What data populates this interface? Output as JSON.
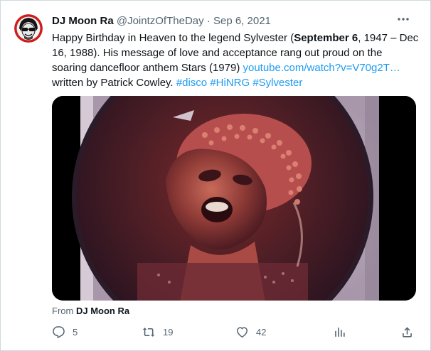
{
  "tweet": {
    "author_name": "DJ Moon Ra",
    "handle": "@JointzOfTheDay",
    "separator": "·",
    "date": "Sep 6, 2021",
    "text_parts": {
      "p1": "Happy Birthday in Heaven to the legend Sylvester (",
      "bold": "September 6",
      "p2": ", 1947 – Dec 16, 1988). His message of love and acceptance rang out proud on the soaring dancefloor anthem Stars (1979) ",
      "link": "youtube.com/watch?v=V70g2T…",
      "p3": " written by Patrick Cowley. ",
      "tag1": "#disco",
      "tag2": "#HiNRG",
      "tag3": "#Sylvester"
    },
    "from_label": "From",
    "from_name": "DJ Moon Ra"
  },
  "actions": {
    "reply_count": "5",
    "retweet_count": "19",
    "like_count": "42"
  },
  "colors": {
    "link": "#1d9bf0",
    "secondary_text": "#536471",
    "primary_text": "#0f1419"
  },
  "icons": {
    "more": "more-horizontal-icon",
    "reply": "reply-icon",
    "retweet": "retweet-icon",
    "like": "heart-icon",
    "views": "analytics-icon",
    "share": "share-icon"
  }
}
